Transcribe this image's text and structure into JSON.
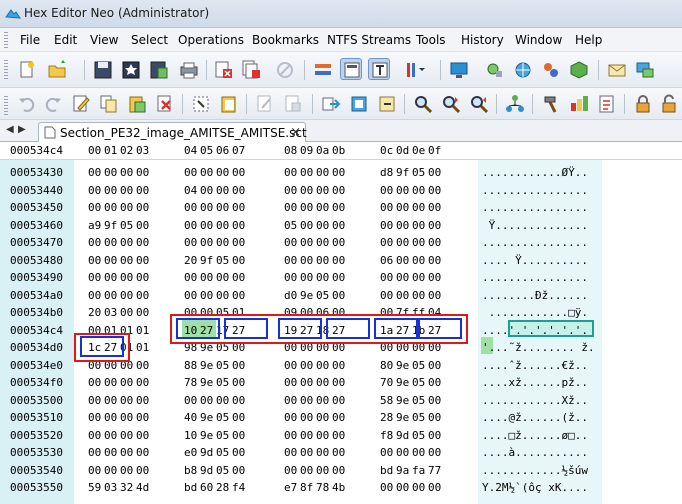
{
  "window": {
    "title": "Hex Editor Neo (Administrator)"
  },
  "menu": [
    "File",
    "Edit",
    "View",
    "Select",
    "Operations",
    "Bookmarks",
    "NTFS Streams",
    "Tools",
    "History",
    "Window",
    "Help"
  ],
  "toolbar1": [
    {
      "icon": "new-file-icon"
    },
    {
      "icon": "open-folder-icon"
    },
    {
      "icon": "save-icon"
    },
    {
      "icon": "save-all-icon"
    },
    {
      "icon": "save-as-icon"
    },
    {
      "icon": "print-icon"
    },
    {
      "icon": "close-file-icon"
    },
    {
      "icon": "close-all-icon"
    },
    {
      "icon": "disabled-link-icon"
    },
    {
      "icon": "compare-icon"
    },
    {
      "icon": "text-view-icon"
    },
    {
      "icon": "hex-text-view-icon"
    },
    {
      "icon": "column-settings-icon"
    },
    {
      "icon": "monitor-icon"
    },
    {
      "icon": "tools-icon"
    },
    {
      "icon": "globe-icon"
    },
    {
      "icon": "pattern-icon"
    },
    {
      "icon": "cube-icon"
    },
    {
      "icon": "mail-icon"
    },
    {
      "icon": "chat-icon"
    }
  ],
  "toolbar2": [
    {
      "icon": "undo-icon"
    },
    {
      "icon": "redo-icon"
    },
    {
      "icon": "edit-icon"
    },
    {
      "icon": "copy-icon"
    },
    {
      "icon": "paste-icon"
    },
    {
      "icon": "delete-icon"
    },
    {
      "icon": "select-icon"
    },
    {
      "icon": "clipboard-icon"
    },
    {
      "icon": "paste-special-icon"
    },
    {
      "icon": "export-icon"
    },
    {
      "icon": "go-to-icon"
    },
    {
      "icon": "bookmark-icon"
    },
    {
      "icon": "find-icon"
    },
    {
      "icon": "find-next-icon"
    },
    {
      "icon": "find-prev-icon"
    },
    {
      "icon": "structure-icon"
    },
    {
      "icon": "hammer-icon"
    },
    {
      "icon": "hierarchy-icon"
    },
    {
      "icon": "document-list-icon"
    },
    {
      "icon": "lock-icon"
    },
    {
      "icon": "unlock-icon"
    }
  ],
  "tab": {
    "label": "Section_PE32_image_AMITSE_AMITSE.sct",
    "close": "×"
  },
  "hex": {
    "header_address": "000534c4",
    "header_columns": [
      "00",
      "01",
      "02",
      "03",
      "04",
      "05",
      "06",
      "07",
      "08",
      "09",
      "0a",
      "0b",
      "0c",
      "0d",
      "0e",
      "0f"
    ],
    "rows": [
      {
        "addr": "00053430",
        "bytes": [
          "00",
          "00",
          "00",
          "00",
          "00",
          "00",
          "00",
          "00",
          "00",
          "00",
          "00",
          "00",
          "d8",
          "9f",
          "05",
          "00"
        ],
        "ascii": "............ØŸ.."
      },
      {
        "addr": "00053440",
        "bytes": [
          "00",
          "00",
          "00",
          "00",
          "04",
          "00",
          "00",
          "00",
          "00",
          "00",
          "00",
          "00",
          "00",
          "00",
          "00",
          "00"
        ],
        "ascii": "................"
      },
      {
        "addr": "00053450",
        "bytes": [
          "00",
          "00",
          "00",
          "00",
          "00",
          "00",
          "00",
          "00",
          "00",
          "00",
          "00",
          "00",
          "00",
          "00",
          "00",
          "00"
        ],
        "ascii": "................"
      },
      {
        "addr": "00053460",
        "bytes": [
          "a9",
          "9f",
          "05",
          "00",
          "00",
          "00",
          "00",
          "00",
          "05",
          "00",
          "00",
          "00",
          "00",
          "00",
          "00",
          "00"
        ],
        "ascii": " Ÿ.............."
      },
      {
        "addr": "00053470",
        "bytes": [
          "00",
          "00",
          "00",
          "00",
          "00",
          "00",
          "00",
          "00",
          "00",
          "00",
          "00",
          "00",
          "00",
          "00",
          "00",
          "00"
        ],
        "ascii": "................"
      },
      {
        "addr": "00053480",
        "bytes": [
          "00",
          "00",
          "00",
          "00",
          "20",
          "9f",
          "05",
          "00",
          "00",
          "00",
          "00",
          "00",
          "06",
          "00",
          "00",
          "00"
        ],
        "ascii": ".... Ÿ.........."
      },
      {
        "addr": "00053490",
        "bytes": [
          "00",
          "00",
          "00",
          "00",
          "00",
          "00",
          "00",
          "00",
          "00",
          "00",
          "00",
          "00",
          "00",
          "00",
          "00",
          "00"
        ],
        "ascii": "................"
      },
      {
        "addr": "000534a0",
        "bytes": [
          "00",
          "00",
          "00",
          "00",
          "00",
          "00",
          "00",
          "00",
          "d0",
          "9e",
          "05",
          "00",
          "00",
          "00",
          "00",
          "00"
        ],
        "ascii": "........Ðž......"
      },
      {
        "addr": "000534b0",
        "bytes": [
          "20",
          "03",
          "00",
          "00",
          "00",
          "00",
          "05",
          "01",
          "09",
          "00",
          "06",
          "00",
          "00",
          "7f",
          "ff",
          "04"
        ],
        "ascii": " ............□ÿ."
      },
      {
        "addr": "000534c4",
        "bytes": [
          "00",
          "01",
          "01",
          "01",
          "10",
          "27",
          "17",
          "27",
          "19",
          "27",
          "18",
          "27",
          "1a",
          "27",
          "1b",
          "27"
        ],
        "ascii": "....'.'.'.'.'.'."
      },
      {
        "addr": "000534d0",
        "bytes": [
          "1c",
          "27",
          "01",
          "01",
          "98",
          "9e",
          "05",
          "00",
          "00",
          "00",
          "00",
          "00",
          "00",
          "00",
          "00",
          "00"
        ],
        "ascii": "'...˜ž........ ž."
      },
      {
        "addr": "000534e0",
        "bytes": [
          "00",
          "00",
          "00",
          "00",
          "88",
          "9e",
          "05",
          "00",
          "00",
          "00",
          "00",
          "00",
          "80",
          "9e",
          "05",
          "00"
        ],
        "ascii": "....ˆž......€ž.."
      },
      {
        "addr": "000534f0",
        "bytes": [
          "00",
          "00",
          "00",
          "00",
          "78",
          "9e",
          "05",
          "00",
          "00",
          "00",
          "00",
          "00",
          "70",
          "9e",
          "05",
          "00"
        ],
        "ascii": "....xž......pž.."
      },
      {
        "addr": "00053500",
        "bytes": [
          "00",
          "00",
          "00",
          "00",
          "00",
          "00",
          "00",
          "00",
          "00",
          "00",
          "00",
          "00",
          "58",
          "9e",
          "05",
          "00"
        ],
        "ascii": "............Xž.."
      },
      {
        "addr": "00053510",
        "bytes": [
          "00",
          "00",
          "00",
          "00",
          "40",
          "9e",
          "05",
          "00",
          "00",
          "00",
          "00",
          "00",
          "28",
          "9e",
          "05",
          "00"
        ],
        "ascii": "....@ž......(ž.."
      },
      {
        "addr": "00053520",
        "bytes": [
          "00",
          "00",
          "00",
          "00",
          "10",
          "9e",
          "05",
          "00",
          "00",
          "00",
          "00",
          "00",
          "f8",
          "9d",
          "05",
          "00"
        ],
        "ascii": "....□ž......ø□.."
      },
      {
        "addr": "00053530",
        "bytes": [
          "00",
          "00",
          "00",
          "00",
          "e0",
          "9d",
          "05",
          "00",
          "00",
          "00",
          "00",
          "00",
          "00",
          "00",
          "00",
          "00"
        ],
        "ascii": "....à..........."
      },
      {
        "addr": "00053540",
        "bytes": [
          "00",
          "00",
          "00",
          "00",
          "b8",
          "9d",
          "05",
          "00",
          "00",
          "00",
          "00",
          "00",
          "bd",
          "9a",
          "fa",
          "77"
        ],
        "ascii": "............½šúw"
      },
      {
        "addr": "00053550",
        "bytes": [
          "59",
          "03",
          "32",
          "4d",
          "bd",
          "60",
          "28",
          "f4",
          "e7",
          "8f",
          "78",
          "4b",
          "00",
          "00",
          "00",
          "00"
        ],
        "ascii": "Y.2M½`(ôç xK...."
      }
    ]
  }
}
